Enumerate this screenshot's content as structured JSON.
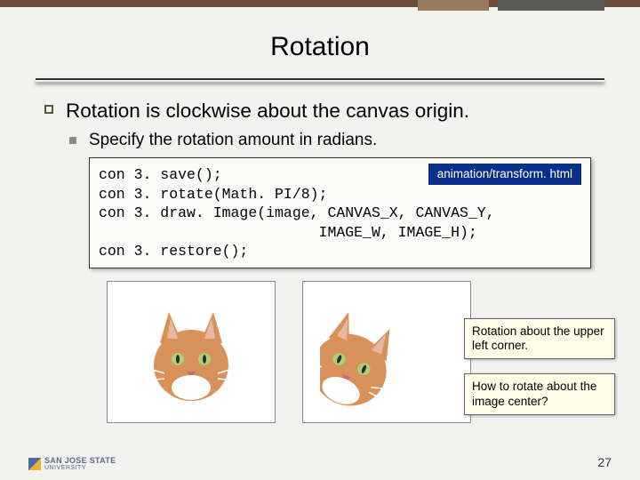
{
  "title": "Rotation",
  "bullet_main": "Rotation is clockwise about the canvas origin.",
  "bullet_sub": "Specify the rotation amount in radians.",
  "code_badge": "animation/transform. html",
  "code": {
    "l1": "con 3. save();",
    "l2": "con 3. rotate(Math. PI/8);",
    "l3": "con 3. draw. Image(image, CANVAS_X, CANVAS_Y,",
    "l4": "                         IMAGE_W, IMAGE_H);",
    "l5": "con 3. restore();"
  },
  "note1": "Rotation about the upper left corner.",
  "note2": "How to rotate about the image center?",
  "logo_text": "SAN JOSE STATE\nUNIVERSITY",
  "page": "27"
}
